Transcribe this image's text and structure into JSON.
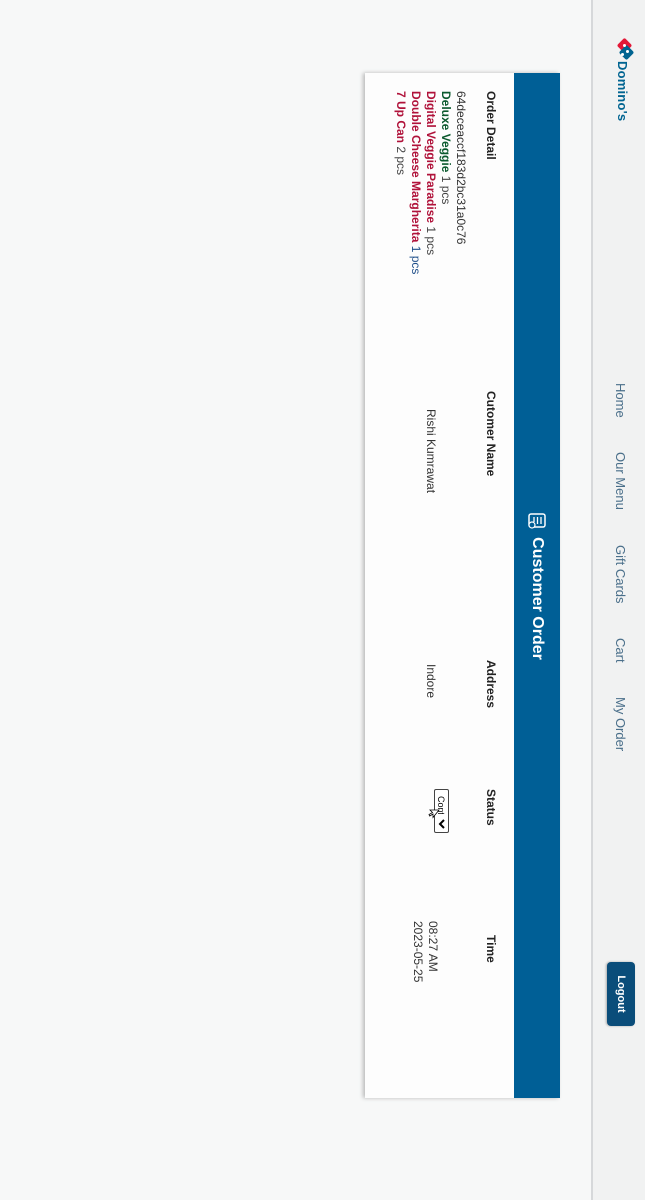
{
  "nav": {
    "brand": "Domino's",
    "links": [
      "Home",
      "Our Menu",
      "Gift Cards",
      "Cart",
      "My Order"
    ],
    "logout": "Logout"
  },
  "card": {
    "title": "Customer Order",
    "columns": {
      "order_detail": "Order Detail",
      "customer_name": "Cutomer Name",
      "address": "Address",
      "status": "Status",
      "time": "Time"
    },
    "order": {
      "id": "64deceaccf183d2bc31a0c76",
      "items": [
        {
          "name": "Deluxe Veggie",
          "qty": "1 pcs",
          "color": "#0b5a2e"
        },
        {
          "name": "Digital Veggie Paradise",
          "qty": "1 pcs",
          "color": "#b0123a"
        },
        {
          "name": "Double Cheese Margherita",
          "qty": "1 pcs",
          "color": "#b0123a"
        },
        {
          "name": "7 Up Can",
          "qty": "2 pcs",
          "color": "#b0123a"
        }
      ],
      "customer": "Rishi Kumrawat",
      "address": "Indore",
      "status": "Confirmed",
      "time": "08:27 AM",
      "date": "2023-05-25"
    }
  },
  "colors": {
    "brand_blue": "#006491",
    "brand_red": "#e31837",
    "header_bg": "#005f96",
    "logout_bg": "#0a4d7a"
  },
  "icons": [
    "domino-logo-icon",
    "order-list-icon",
    "cursor-icon",
    "chevron-down-icon"
  ]
}
